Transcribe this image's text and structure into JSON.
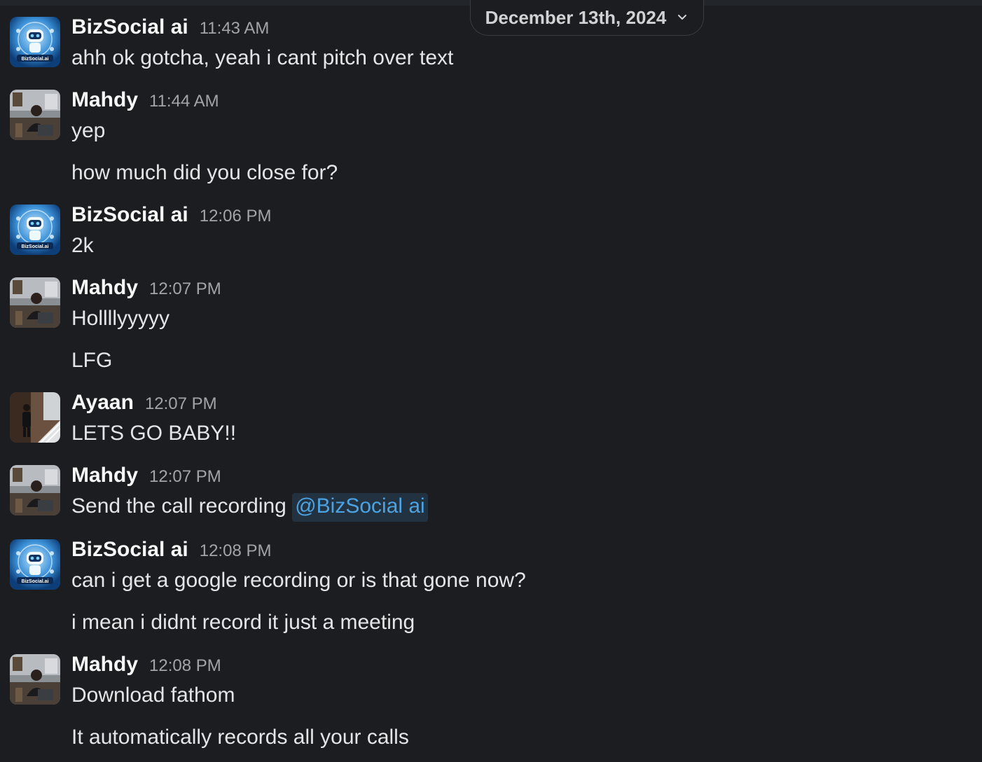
{
  "date_divider": {
    "label": "December 13th, 2024"
  },
  "colors": {
    "background": "#1b1d21",
    "mention_bg": "#233240",
    "mention_text": "#4ba3e3",
    "time": "#a3a4a6"
  },
  "messages": [
    {
      "author": "BizSocial ai",
      "time": "11:43 AM",
      "avatar": "bizsocial-robot-icon",
      "avatar_text": "BizSocial.ai",
      "lines": [
        "ahh ok gotcha, yeah i cant pitch over text"
      ]
    },
    {
      "author": "Mahdy",
      "time": "11:44 AM",
      "avatar": "mahdy-photo",
      "lines": [
        "yep",
        "how much did you close for?"
      ]
    },
    {
      "author": "BizSocial ai",
      "time": "12:06 PM",
      "avatar": "bizsocial-robot-icon",
      "avatar_text": "BizSocial.ai",
      "lines": [
        "2k"
      ]
    },
    {
      "author": "Mahdy",
      "time": "12:07 PM",
      "avatar": "mahdy-photo",
      "lines": [
        "Hollllyyyyy",
        "LFG"
      ]
    },
    {
      "author": "Ayaan",
      "time": "12:07 PM",
      "avatar": "ayaan-photo",
      "lines": [
        "LETS GO BABY!!"
      ]
    },
    {
      "author": "Mahdy",
      "time": "12:07 PM",
      "avatar": "mahdy-photo",
      "lines": [
        "Send the call recording "
      ],
      "mention": "@BizSocial ai"
    },
    {
      "author": "BizSocial ai",
      "time": "12:08 PM",
      "avatar": "bizsocial-robot-icon",
      "avatar_text": "BizSocial.ai",
      "lines": [
        "can i get a google recording or is that gone now?",
        "i mean i didnt record it just a meeting"
      ]
    },
    {
      "author": "Mahdy",
      "time": "12:08 PM",
      "avatar": "mahdy-photo",
      "lines": [
        "Download fathom",
        "It automatically records all your calls"
      ]
    }
  ]
}
